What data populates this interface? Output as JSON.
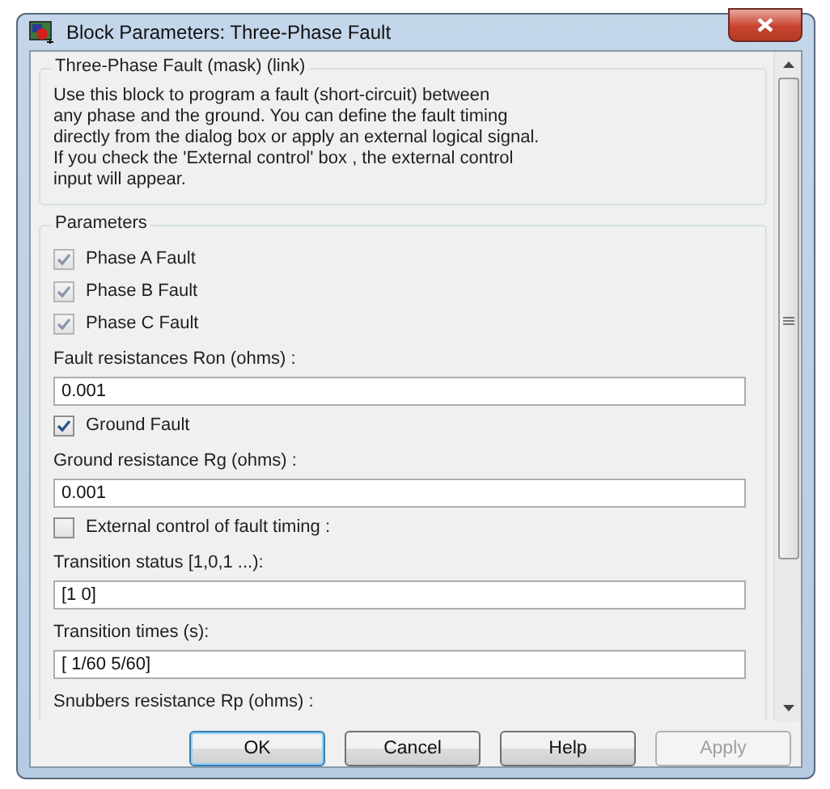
{
  "window": {
    "title": "Block Parameters: Three-Phase Fault"
  },
  "description": {
    "title": "Three-Phase Fault (mask) (link)",
    "lines": [
      "Use this block to program a fault (short-circuit) between",
      "any phase and the ground. You can define the fault timing",
      "directly from the dialog box or apply an external logical signal.",
      "If you check the 'External control' box , the external control",
      "input will appear."
    ]
  },
  "parameters": {
    "title": "Parameters",
    "items": [
      {
        "kind": "checkbox",
        "label": "Phase A Fault",
        "checked": true,
        "disabled": true
      },
      {
        "kind": "checkbox",
        "label": "Phase B Fault",
        "checked": true,
        "disabled": true
      },
      {
        "kind": "checkbox",
        "label": "Phase C Fault",
        "checked": true,
        "disabled": true
      },
      {
        "kind": "field",
        "label": "Fault resistances  Ron (ohms) :",
        "value": "0.001"
      },
      {
        "kind": "checkbox",
        "label": "Ground Fault",
        "checked": true,
        "disabled": false
      },
      {
        "kind": "field",
        "label": "Ground resistance Rg (ohms) :",
        "value": "0.001"
      },
      {
        "kind": "checkbox",
        "label": "External control of fault timing :",
        "checked": false,
        "disabled": false
      },
      {
        "kind": "field",
        "label": "Transition status [1,0,1 ...):",
        "value": "[1 0]"
      },
      {
        "kind": "field",
        "label": "Transition times (s):",
        "value": "[ 1/60 5/60]"
      },
      {
        "kind": "label",
        "label": "Snubbers resistance Rp (ohms) :"
      }
    ]
  },
  "buttons": [
    {
      "label": "OK",
      "default": true,
      "disabled": false
    },
    {
      "label": "Cancel",
      "default": false,
      "disabled": false
    },
    {
      "label": "Help",
      "default": false,
      "disabled": false
    },
    {
      "label": "Apply",
      "default": false,
      "disabled": true
    }
  ]
}
